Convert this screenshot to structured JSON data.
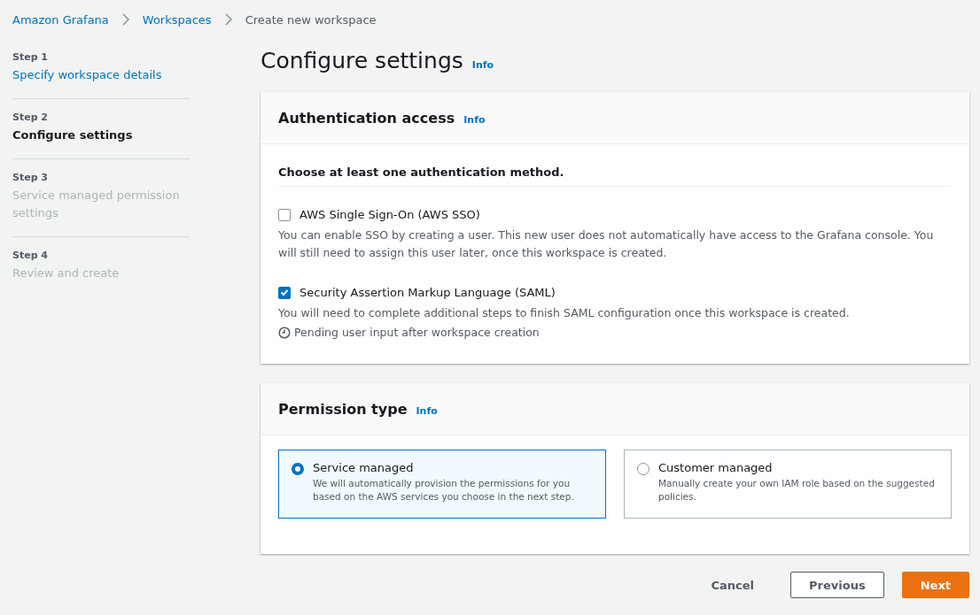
{
  "breadcrumbs": [
    {
      "label": "Amazon Grafana",
      "kind": "link"
    },
    {
      "label": "Workspaces",
      "kind": "link"
    },
    {
      "label": "Create new workspace",
      "kind": "current"
    }
  ],
  "steps": [
    {
      "step": "Step 1",
      "label": "Specify workspace details",
      "kind": "link"
    },
    {
      "step": "Step 2",
      "label": "Configure settings",
      "kind": "current"
    },
    {
      "step": "Step 3",
      "label": "Service managed permission settings",
      "kind": "disabled"
    },
    {
      "step": "Step 4",
      "label": "Review and create",
      "kind": "disabled"
    }
  ],
  "page_title": "Configure settings",
  "page_info": "Info",
  "authentication": {
    "title": "Authentication access",
    "info": "Info",
    "subtitle": "Choose at least one authentication method.",
    "options": [
      {
        "label": "AWS Single Sign-On (AWS SSO)",
        "checked": false,
        "description": "You can enable SSO by creating a user. This new user does not automatically have access to the Grafana console. You will still need to assign this user later, once this workspace is created."
      },
      {
        "label": "Security Assertion Markup Language (SAML)",
        "checked": true,
        "description": "You will need to complete additional steps to finish SAML configuration once this workspace is created.",
        "status": "Pending user input after workspace creation"
      }
    ]
  },
  "permission": {
    "title": "Permission type",
    "info": "Info",
    "options": [
      {
        "label": "Service managed",
        "selected": true,
        "description": "We will automatically provision the permissions for you based on the AWS services you choose in the next step."
      },
      {
        "label": "Customer managed",
        "selected": false,
        "description": "Manually create your own IAM role based on the suggested policies."
      }
    ]
  },
  "buttons": [
    {
      "label": "Cancel",
      "kind": "link"
    },
    {
      "label": "Previous",
      "kind": "normal"
    },
    {
      "label": "Next",
      "kind": "primary"
    }
  ]
}
